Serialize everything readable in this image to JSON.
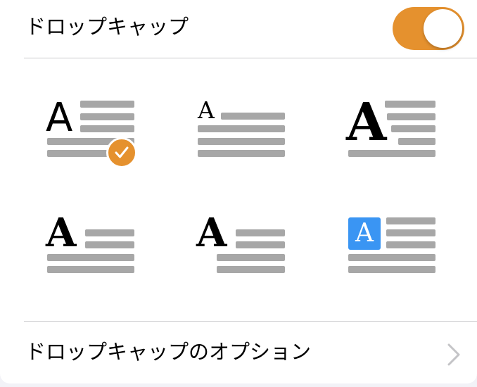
{
  "drop_cap": {
    "label": "ドロップキャップ",
    "toggle_on": true,
    "accent_color": "#e5912e"
  },
  "styles": [
    {
      "cap_letter": "A",
      "style": "sans-lines-beside",
      "selected": true,
      "icon": "checkmark-icon"
    },
    {
      "cap_letter": "A",
      "style": "small-serif-inline",
      "selected": false
    },
    {
      "cap_letter": "A",
      "style": "large-serif-bold",
      "selected": false
    },
    {
      "cap_letter": "A",
      "style": "serif-two-lines",
      "selected": false
    },
    {
      "cap_letter": "A",
      "style": "serif-indented",
      "selected": false
    },
    {
      "cap_letter": "A",
      "style": "boxed-blue",
      "selected": false,
      "box_color": "#3a95f3"
    }
  ],
  "options": {
    "label": "ドロップキャップのオプション",
    "icon": "chevron-right-icon"
  },
  "colors": {
    "line_gray": "#a7a7a7",
    "divider": "#c8c8cc",
    "background": "#ffffff"
  }
}
